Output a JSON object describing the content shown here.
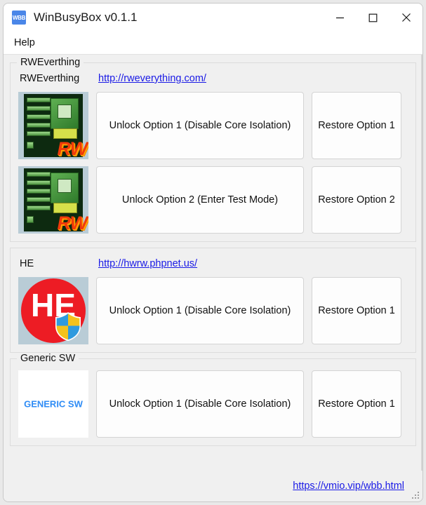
{
  "window": {
    "app_icon_text": "WBB",
    "title": "WinBusyBox v0.1.1",
    "controls": {
      "minimize": "minimize-icon",
      "maximize": "maximize-icon",
      "close": "close-icon"
    }
  },
  "menubar": {
    "items": [
      {
        "label": "Help"
      }
    ]
  },
  "groups": [
    {
      "legend": "RWEverthing",
      "name": "RWEverthing",
      "url": "http://rweverything.com/",
      "logo": {
        "kind": "rw-everything-logo",
        "text": "RW"
      },
      "rows": [
        {
          "unlock_label": "Unlock Option 1 (Disable Core Isolation)",
          "restore_label": "Restore Option 1"
        },
        {
          "unlock_label": "Unlock Option 2 (Enter Test Mode)",
          "restore_label": "Restore Option 2"
        }
      ]
    },
    {
      "legend": "",
      "name": "HE",
      "url": "http://hwrw.phpnet.us/",
      "logo": {
        "kind": "he-logo",
        "text": "HE"
      },
      "rows": [
        {
          "unlock_label": "Unlock Option 1 (Disable Core Isolation)",
          "restore_label": "Restore Option 1"
        }
      ]
    },
    {
      "legend": "Generic SW",
      "name": "",
      "url": "",
      "logo": {
        "kind": "generic-sw-logo",
        "text": "GENERIC SW"
      },
      "rows": [
        {
          "unlock_label": "Unlock Option 1 (Disable Core Isolation)",
          "restore_label": "Restore Option 1"
        }
      ]
    }
  ],
  "footer": {
    "link": "https://vmio.vip/wbb.html"
  },
  "colors": {
    "link": "#1a1ae6",
    "window_bg": "#f0f0f0",
    "titlebar_bg": "#ffffff",
    "button_bg": "#fdfdfd",
    "accent_icon": "#4a86e8",
    "he_red": "#ed1c24",
    "generic_blue": "#2f8cf5"
  }
}
